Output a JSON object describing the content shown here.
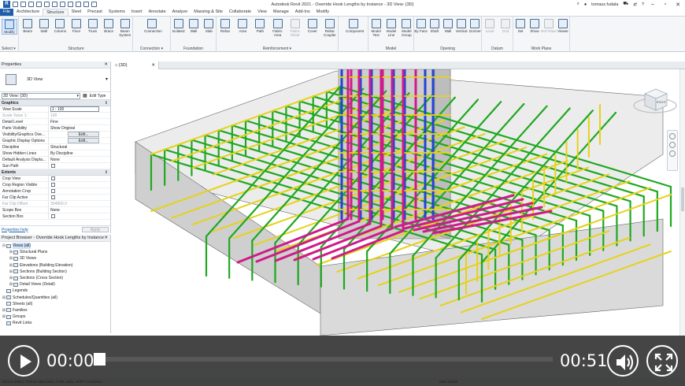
{
  "window": {
    "title": "Autodesk Revit 2021 - Override Hook Lengths by Instance - 3D View: {3D}",
    "user": "tomasz.fudala",
    "help": "?"
  },
  "ribbon_tabs": [
    "File",
    "Architecture",
    "Structure",
    "Steel",
    "Precast",
    "Systems",
    "Insert",
    "Annotate",
    "Analyze",
    "Massing & Site",
    "Collaborate",
    "View",
    "Manage",
    "Add-Ins",
    "Modify"
  ],
  "active_tab": "Structure",
  "ribbon": {
    "modify_label": "Modify",
    "select_label": "Select ▾",
    "panels": [
      {
        "title": "Structure",
        "buttons": [
          "Beam",
          "Wall",
          "Column",
          "Floor",
          "Truss",
          "Brace",
          "Beam System"
        ]
      },
      {
        "title": "Connection ▾",
        "buttons": [
          "Connection"
        ]
      },
      {
        "title": "Foundation",
        "buttons": [
          "Isolated",
          "Wall",
          "Slab"
        ]
      },
      {
        "title": "Reinforcement ▾",
        "buttons": [
          "Rebar",
          "Area",
          "Path",
          "Fabric Area",
          "Fabric Sheet",
          "Cover",
          "Rebar Coupler"
        ]
      },
      {
        "title": "",
        "buttons": [
          "Component"
        ]
      },
      {
        "title": "Model",
        "buttons": [
          "Model Text",
          "Model Line",
          "Model Group"
        ]
      },
      {
        "title": "Opening",
        "buttons": [
          "By Face",
          "Shaft",
          "Wall",
          "Vertical",
          "Dormer"
        ]
      },
      {
        "title": "Datum",
        "buttons": [
          "Level",
          "Grid"
        ]
      },
      {
        "title": "Work Plane",
        "buttons": [
          "Set",
          "Show",
          "Ref Plane",
          "Viewer"
        ]
      }
    ]
  },
  "properties": {
    "title": "Properties",
    "type_name": "3D View",
    "instance_selector": "3D View: {3D}",
    "edit_type": "Edit Type",
    "groups": [
      {
        "name": "Graphics",
        "rows": [
          {
            "label": "View Scale",
            "value": "1 : 100",
            "kind": "field"
          },
          {
            "label": "Scale Value  1:",
            "value": "100",
            "kind": "ro"
          },
          {
            "label": "Detail Level",
            "value": "Fine"
          },
          {
            "label": "Parts Visibility",
            "value": "Show Original"
          },
          {
            "label": "Visibility/Graphics Ove...",
            "value": "Edit...",
            "kind": "btn"
          },
          {
            "label": "Graphic Display Options",
            "value": "Edit...",
            "kind": "btn"
          },
          {
            "label": "Discipline",
            "value": "Structural"
          },
          {
            "label": "Show Hidden Lines",
            "value": "By Discipline"
          },
          {
            "label": "Default Analysis Displa...",
            "value": "None"
          },
          {
            "label": "Sun Path",
            "value": "",
            "kind": "chk"
          }
        ]
      },
      {
        "name": "Extents",
        "rows": [
          {
            "label": "Crop View",
            "value": "",
            "kind": "chk"
          },
          {
            "label": "Crop Region Visible",
            "value": "",
            "kind": "chk"
          },
          {
            "label": "Annotation Crop",
            "value": "",
            "kind": "chk"
          },
          {
            "label": "Far Clip Active",
            "value": "",
            "kind": "chk"
          },
          {
            "label": "Far Clip Offset",
            "value": "304800.0",
            "kind": "ro"
          },
          {
            "label": "Scope Box",
            "value": "None"
          },
          {
            "label": "Section Box",
            "value": "",
            "kind": "chk"
          }
        ]
      }
    ],
    "help_link": "Properties help",
    "apply_label": "Apply"
  },
  "project_browser": {
    "title": "Project Browser - Override Hook Lengths by Instance",
    "nodes": [
      {
        "label": "Views (all)",
        "level": 0,
        "toggle": "⊟",
        "selected": true
      },
      {
        "label": "Structural Plans",
        "level": 1,
        "toggle": "⊞"
      },
      {
        "label": "3D Views",
        "level": 1,
        "toggle": "⊞"
      },
      {
        "label": "Elevations (Building Elevation)",
        "level": 1,
        "toggle": "⊞"
      },
      {
        "label": "Sections (Building Section)",
        "level": 1,
        "toggle": "⊞"
      },
      {
        "label": "Sections (Cross Section)",
        "level": 1,
        "toggle": "⊞"
      },
      {
        "label": "Detail Views (Detail)",
        "level": 1,
        "toggle": "⊞"
      },
      {
        "label": "Legends",
        "level": 0,
        "toggle": ""
      },
      {
        "label": "Schedules/Quantities (all)",
        "level": 0,
        "toggle": "⊞"
      },
      {
        "label": "Sheets (all)",
        "level": 0,
        "toggle": ""
      },
      {
        "label": "Families",
        "level": 0,
        "toggle": "⊞"
      },
      {
        "label": "Groups",
        "level": 0,
        "toggle": "⊞"
      },
      {
        "label": "Revit Links",
        "level": 0,
        "toggle": ""
      }
    ]
  },
  "view_tab": "{3D}",
  "viewcube_label": "RIGHT",
  "status_text": "Click to select, TAB for alternates, CTRL adds, SHIFT unselects.",
  "status_model": "Main Model",
  "player": {
    "current_time": "00:00",
    "total_time": "00:51",
    "progress": 0.0
  },
  "colors": {
    "rebar_stirrup": "#1fa81f",
    "rebar_mesh": "#e6d21a",
    "rebar_column": "#2343d6",
    "rebar_bent": "#d01a8a",
    "concrete": "#d9d9d9"
  }
}
